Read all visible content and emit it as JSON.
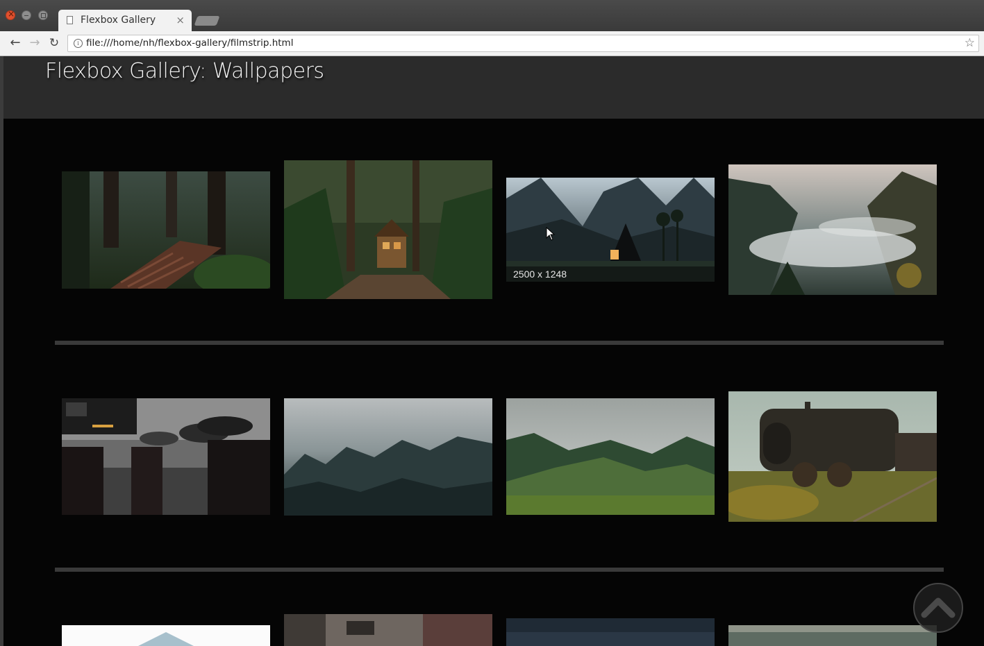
{
  "browser": {
    "tab_title": "Flexbox Gallery",
    "tab_close": "×",
    "url": "file:///home/nh/flexbox-gallery/filmstrip.html",
    "nav": {
      "back": "←",
      "forward": "→",
      "reload": "↻"
    },
    "star": "☆"
  },
  "page": {
    "title": "Flexbox Gallery: Wallpapers"
  },
  "gallery": {
    "hover_caption": "2500 x 1248",
    "images": [
      {
        "name": "forest-stairs",
        "icon": "photo-forest-steps"
      },
      {
        "name": "forest-cabin",
        "icon": "photo-cabin-woods"
      },
      {
        "name": "mountain-house",
        "icon": "photo-mountain-house"
      },
      {
        "name": "misty-valley",
        "icon": "photo-misty-valley"
      },
      {
        "name": "rainy-street",
        "icon": "photo-umbrella-street"
      },
      {
        "name": "foggy-forest",
        "icon": "photo-foggy-pines"
      },
      {
        "name": "green-hills",
        "icon": "photo-green-hills"
      },
      {
        "name": "old-locomotive",
        "icon": "photo-steam-train"
      },
      {
        "name": "white-image",
        "icon": "photo-partial-1"
      },
      {
        "name": "stone-street",
        "icon": "photo-partial-2"
      },
      {
        "name": "dark-sky",
        "icon": "photo-partial-3"
      },
      {
        "name": "sea",
        "icon": "photo-partial-4"
      }
    ]
  },
  "colors": {
    "page_bg": "#050505",
    "header_bg": "#2b2b2b",
    "divider": "#3a3a3a"
  }
}
